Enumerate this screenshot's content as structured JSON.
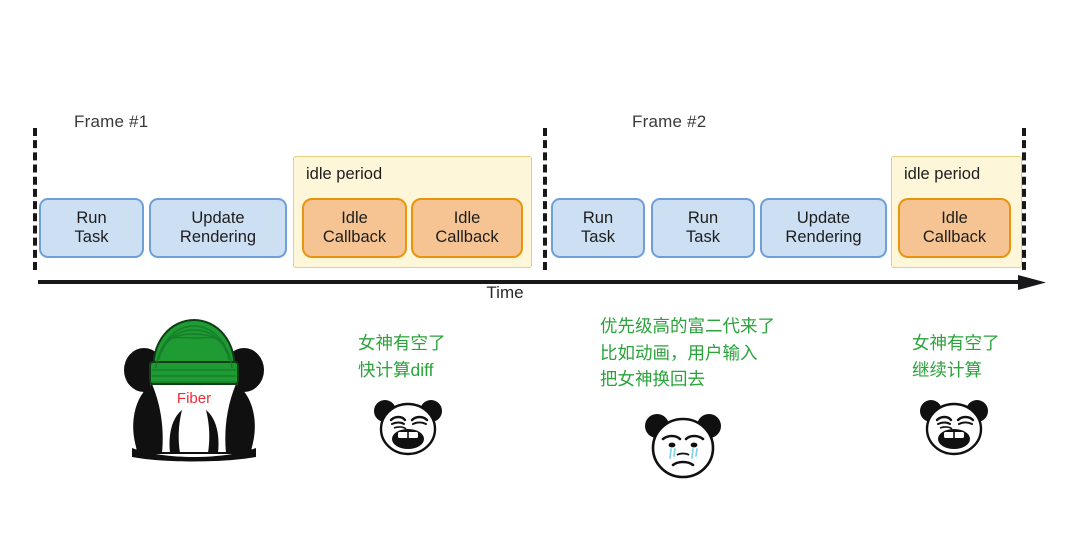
{
  "diagram": {
    "title_axis_label": "Time",
    "frames": [
      {
        "label": "Frame #1"
      },
      {
        "label": "Frame #2"
      }
    ],
    "idle_period_label": "idle period",
    "frame1_tasks": [
      {
        "line1": "Run",
        "line2": "Task",
        "kind": "blue"
      },
      {
        "line1": "Update",
        "line2": "Rendering",
        "kind": "blue"
      },
      {
        "line1": "Idle",
        "line2": "Callback",
        "kind": "orange"
      },
      {
        "line1": "Idle",
        "line2": "Callback",
        "kind": "orange"
      }
    ],
    "frame2_tasks": [
      {
        "line1": "Run",
        "line2": "Task",
        "kind": "blue"
      },
      {
        "line1": "Run",
        "line2": "Task",
        "kind": "blue"
      },
      {
        "line1": "Update",
        "line2": "Rendering",
        "kind": "blue"
      },
      {
        "line1": "Idle",
        "line2": "Callback",
        "kind": "orange"
      }
    ],
    "notes": [
      {
        "lines": [
          "女神有空了",
          "快计算diff"
        ]
      },
      {
        "lines": [
          "优先级高的富二代来了",
          "比如动画，用户输入",
          "把女神换回去"
        ]
      },
      {
        "lines": [
          "女神有空了",
          "继续计算"
        ]
      }
    ],
    "fiber_badge": "Fiber",
    "colors": {
      "blue_fill": "#cddff2",
      "blue_border": "#6f9fd8",
      "orange_fill": "#f6c492",
      "orange_border": "#e8940d",
      "idle_fill": "#fdf6d9",
      "idle_border": "#e5cf7a",
      "note_green": "#2aa33a",
      "fiber_red": "#ef2b36",
      "hat_green": "#1f9b33",
      "axis_black": "#18181a"
    }
  }
}
